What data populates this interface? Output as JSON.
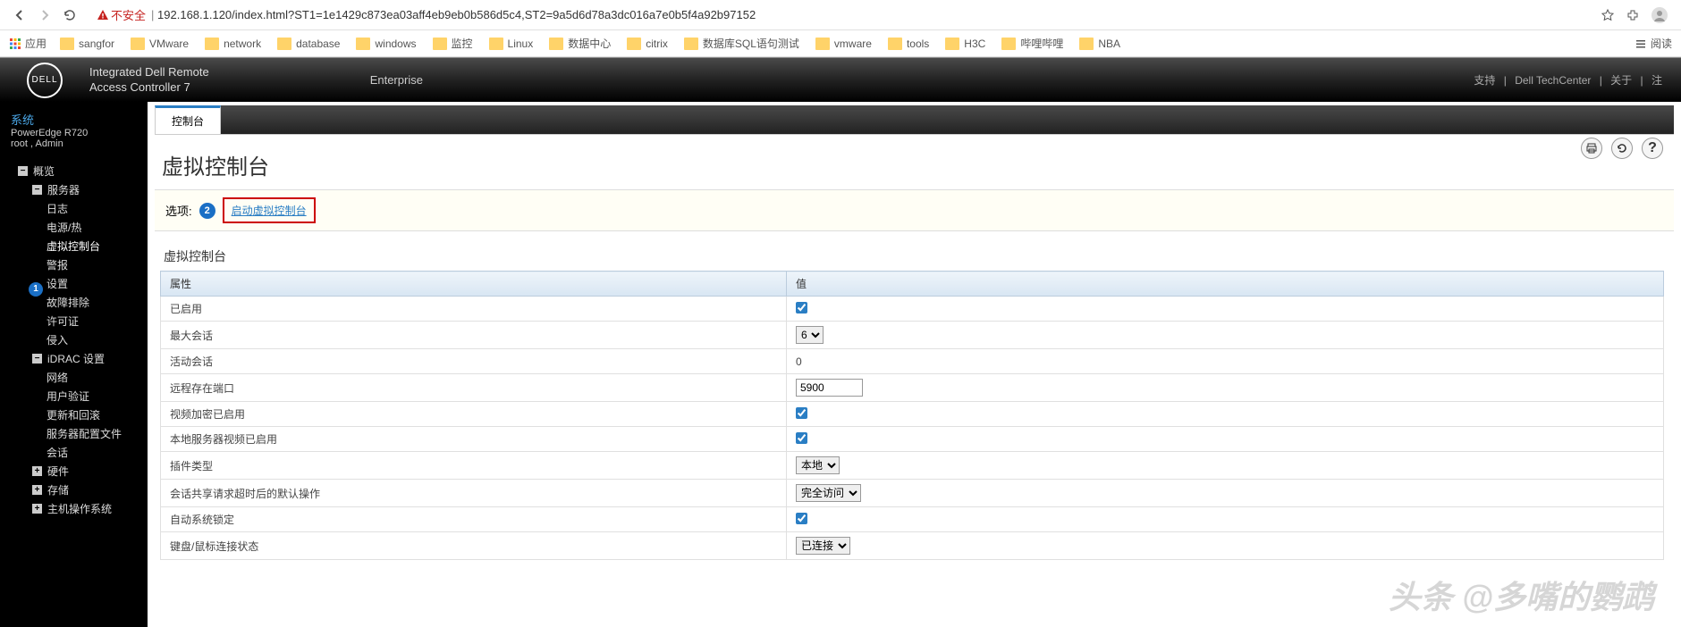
{
  "browser": {
    "url": "192.168.1.120/index.html?ST1=1e1429c873ea03aff4eb9eb0b586d5c4,ST2=9a5d6d78a3dc016a7e0b5f4a92b97152",
    "insecure_label": "不安全",
    "reading_list_label": "阅读"
  },
  "bookmarks": {
    "apps_label": "应用",
    "items": [
      "sangfor",
      "VMware",
      "network",
      "database",
      "windows",
      "监控",
      "Linux",
      "数据中心",
      "citrix",
      "数据库SQL语句测试",
      "vmware",
      "tools",
      "H3C",
      "哔哩哔哩",
      "NBA"
    ]
  },
  "idrac_header": {
    "logo_text": "DELL",
    "title_line1": "Integrated Dell Remote",
    "title_line2": "Access Controller 7",
    "edition": "Enterprise",
    "links": {
      "support": "支持",
      "techcenter": "Dell TechCenter",
      "about": "关于",
      "logout": "注"
    }
  },
  "sidebar": {
    "system_label": "系统",
    "model": "PowerEdge R720",
    "user": "root , Admin",
    "items": {
      "overview": "概览",
      "server": "服务器",
      "logs": "日志",
      "power": "电源/热",
      "console": "虚拟控制台",
      "alerts": "警报",
      "settings": "设置",
      "troubleshoot": "故障排除",
      "license": "许可证",
      "intrusion": "侵入",
      "idrac_settings": "iDRAC 设置",
      "network": "网络",
      "user_auth": "用户验证",
      "update_rollback": "更新和回滚",
      "server_profile": "服务器配置文件",
      "sessions": "会话",
      "hardware": "硬件",
      "storage": "存储",
      "host_os": "主机操作系统"
    }
  },
  "content": {
    "tab_label": "控制台",
    "page_title": "虚拟控制台",
    "options_label": "选项:",
    "launch_label": "启动虚拟控制台",
    "section_title": "虚拟控制台",
    "table": {
      "header_attr": "属性",
      "header_val": "值",
      "rows": {
        "enabled": {
          "label": "已启用",
          "checked": true
        },
        "max_sessions": {
          "label": "最大会话",
          "value": "6"
        },
        "active_sessions": {
          "label": "活动会话",
          "value": "0"
        },
        "remote_port": {
          "label": "远程存在端口",
          "value": "5900"
        },
        "video_encrypt": {
          "label": "视频加密已启用",
          "checked": true
        },
        "local_video": {
          "label": "本地服务器视频已启用",
          "checked": true
        },
        "plugin_type": {
          "label": "插件类型",
          "value": "本地"
        },
        "session_share": {
          "label": "会话共享请求超时后的默认操作",
          "value": "完全访问"
        },
        "auto_lock": {
          "label": "自动系统锁定",
          "checked": true
        },
        "kbm_status": {
          "label": "键盘/鼠标连接状态",
          "value": "已连接"
        }
      }
    },
    "watermark": "头条 @多嘴的鹦鹉"
  }
}
